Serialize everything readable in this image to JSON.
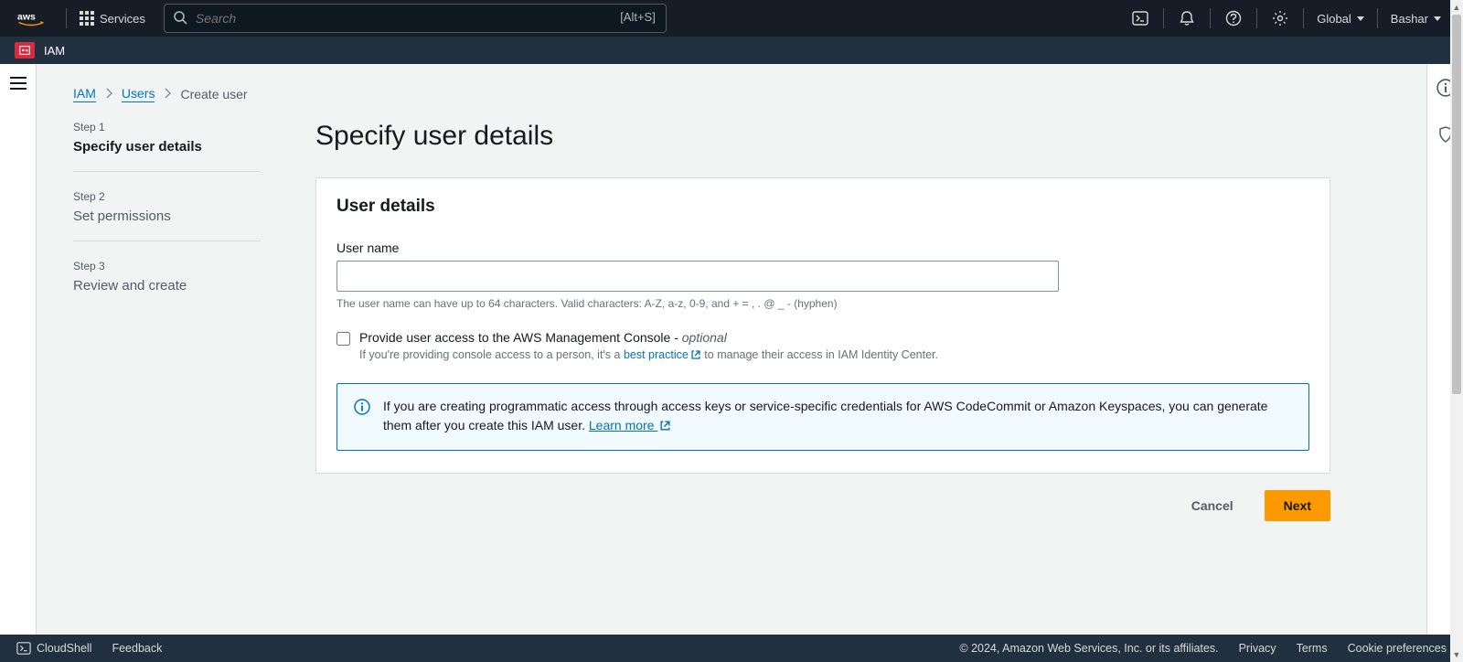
{
  "topnav": {
    "services_label": "Services",
    "search_placeholder": "Search",
    "search_shortcut": "[Alt+S]",
    "region": "Global",
    "user": "Bashar"
  },
  "servicebar": {
    "service_name": "IAM"
  },
  "breadcrumbs": {
    "iam": "IAM",
    "users": "Users",
    "current": "Create user"
  },
  "steps": {
    "s1_small": "Step 1",
    "s1_title": "Specify user details",
    "s2_small": "Step 2",
    "s2_title": "Set permissions",
    "s3_small": "Step 3",
    "s3_title": "Review and create"
  },
  "page": {
    "heading": "Specify user details",
    "panel_title": "User details",
    "field_label": "User name",
    "field_help": "The user name can have up to 64 characters. Valid characters: A-Z, a-z, 0-9, and + = , . @ _ - (hyphen)",
    "checkbox_label_main": "Provide user access to the AWS Management Console - ",
    "checkbox_label_opt": "optional",
    "checkbox_help_pre": "If you're providing console access to a person, it's a ",
    "checkbox_help_link": "best practice",
    "checkbox_help_post": " to manage their access in IAM Identity Center.",
    "info_text_pre": "If you are creating programmatic access through access keys or service-specific credentials for AWS CodeCommit or Amazon Keyspaces, you can generate them after you create this IAM user. ",
    "info_link": "Learn more",
    "btn_cancel": "Cancel",
    "btn_next": "Next"
  },
  "footer": {
    "cloudshell": "CloudShell",
    "feedback": "Feedback",
    "copyright": "© 2024, Amazon Web Services, Inc. or its affiliates.",
    "privacy": "Privacy",
    "terms": "Terms",
    "cookies": "Cookie preferences"
  }
}
